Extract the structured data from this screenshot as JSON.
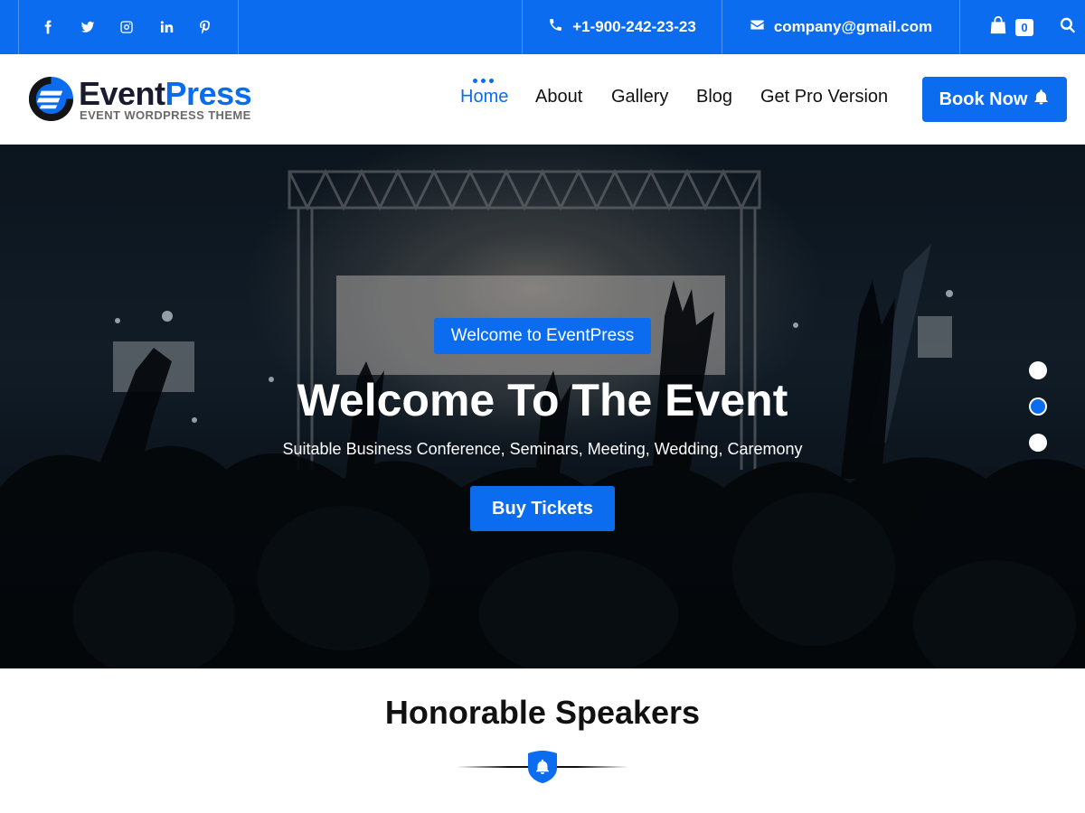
{
  "topbar": {
    "social": [
      "facebook-icon",
      "twitter-icon",
      "instagram-icon",
      "linkedin-icon",
      "pinterest-icon"
    ],
    "phone": "+1-900-242-23-23",
    "email": "company@gmail.com",
    "cart_count": "0"
  },
  "logo": {
    "name_part1": "Event",
    "name_part2": "Press",
    "tagline": "EVENT WORDPRESS THEME"
  },
  "nav": {
    "items": [
      {
        "label": "Home",
        "active": true
      },
      {
        "label": "About"
      },
      {
        "label": "Gallery"
      },
      {
        "label": "Blog"
      },
      {
        "label": "Get Pro Version"
      }
    ],
    "cta": "Book Now"
  },
  "hero": {
    "badge": "Welcome to EventPress",
    "title": "Welcome To The Event",
    "subtitle": "Suitable Business Conference, Seminars, Meeting, Wedding, Caremony",
    "button": "Buy Tickets",
    "slide_count": 3,
    "active_slide": 2
  },
  "speakers": {
    "title": "Honorable Speakers"
  },
  "colors": {
    "accent": "#0b6cf0",
    "dark": "#111111"
  }
}
